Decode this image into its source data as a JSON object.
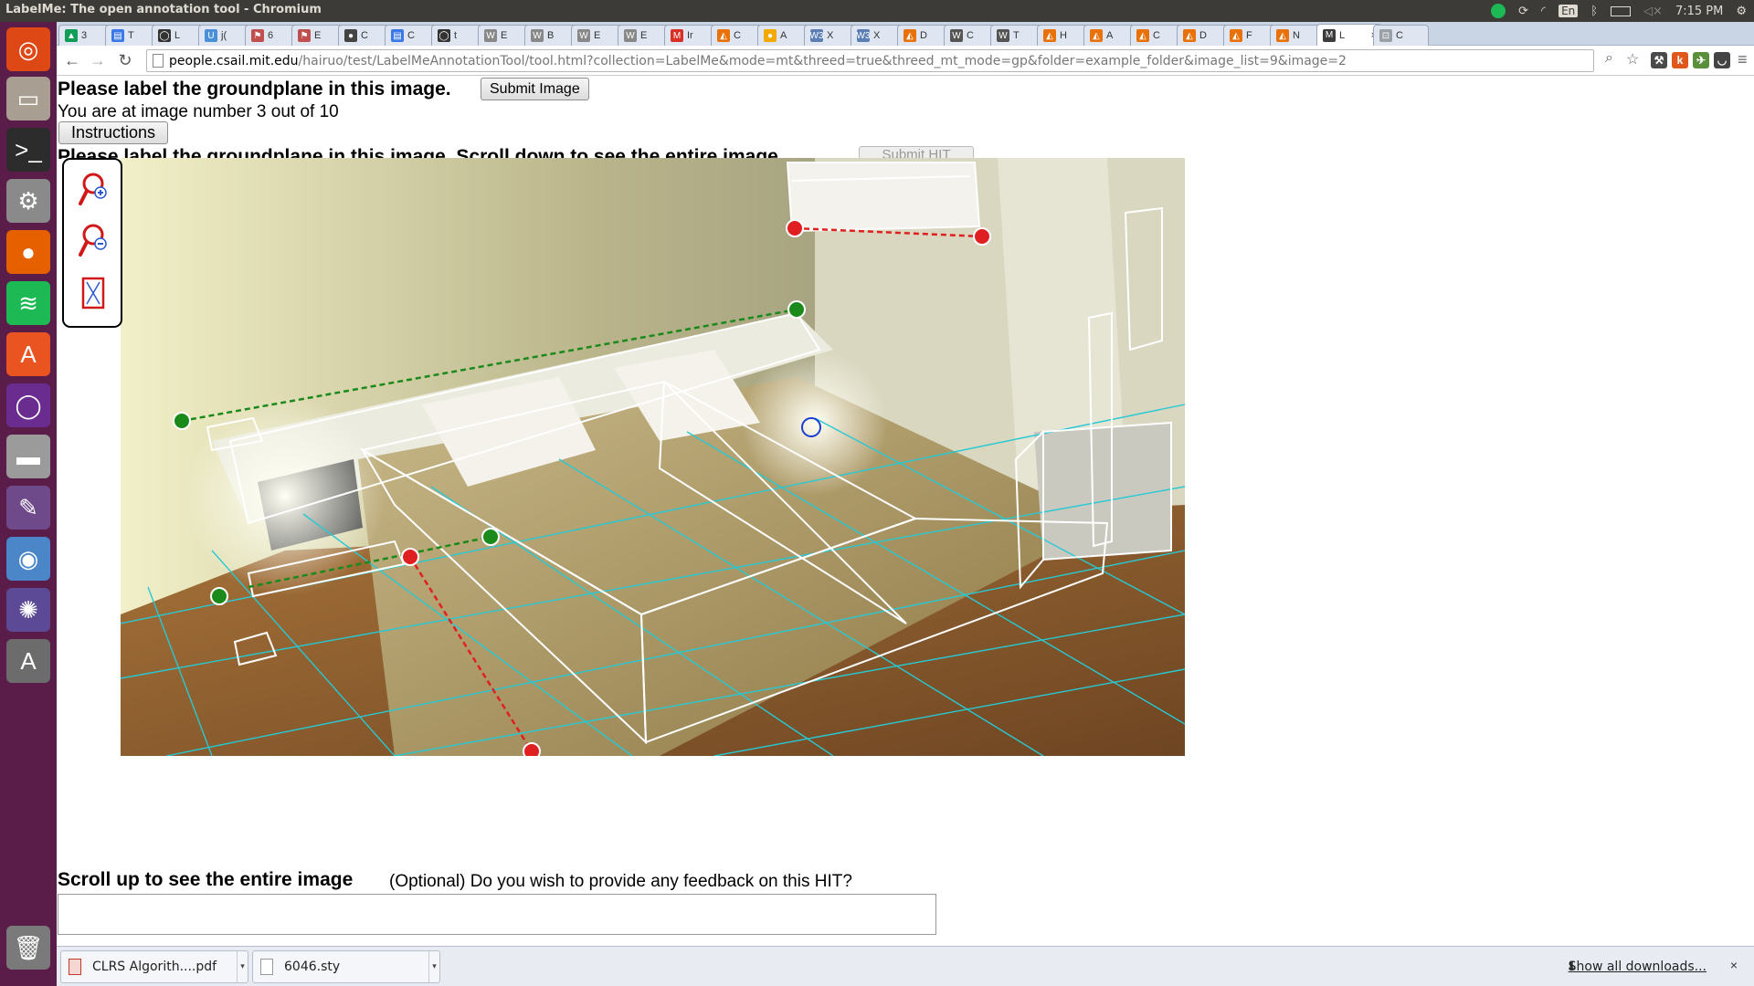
{
  "window": {
    "title": "LabelMe: The open annotation tool - Chromium"
  },
  "top_panel": {
    "keyboard_layout": "En",
    "clock": "7:15 PM",
    "tray_icons": [
      "spotify-icon",
      "sync-icon",
      "wifi-icon",
      "keyboard-icon",
      "bluetooth-icon",
      "battery-icon",
      "volume-icon",
      "settings-gear-icon"
    ]
  },
  "launcher": {
    "items": [
      {
        "name": "ubuntu-dash-icon",
        "color": "#dd4814",
        "glyph": "◎"
      },
      {
        "name": "files-icon",
        "color": "#a89f92",
        "glyph": "▭"
      },
      {
        "name": "terminal-icon",
        "color": "#2c2c2c",
        "glyph": ">_"
      },
      {
        "name": "system-settings-icon",
        "color": "#8a8a8a",
        "glyph": "⚙"
      },
      {
        "name": "firefox-icon",
        "color": "#e66000",
        "glyph": "●"
      },
      {
        "name": "spotify-icon",
        "color": "#1db954",
        "glyph": "≋"
      },
      {
        "name": "software-center-icon",
        "color": "#e95420",
        "glyph": "A"
      },
      {
        "name": "app-circle-icon",
        "color": "#6a2c8f",
        "glyph": "◯"
      },
      {
        "name": "disk-icon",
        "color": "#9b9b9b",
        "glyph": "▬"
      },
      {
        "name": "texmaker-icon",
        "color": "#6f4a8a",
        "glyph": "✎"
      },
      {
        "name": "chromium-icon",
        "color": "#4a86c8",
        "glyph": "◉"
      },
      {
        "name": "shotwell-icon",
        "color": "#5c4a96",
        "glyph": "✺"
      },
      {
        "name": "update-manager-icon",
        "color": "#6c6c6c",
        "glyph": "A"
      },
      {
        "name": "trash-icon",
        "color": "#7a7a7a",
        "glyph": "🗑"
      }
    ]
  },
  "tabs": [
    {
      "label": "3",
      "fav_color": "#0f9d58",
      "fav": "▲"
    },
    {
      "label": "T",
      "fav_color": "#3b78e7",
      "fav": "▤"
    },
    {
      "label": "L",
      "fav_color": "#333333",
      "fav": "◯"
    },
    {
      "label": "j(",
      "fav_color": "#4a90d9",
      "fav": "U"
    },
    {
      "label": "6",
      "fav_color": "#c0504d",
      "fav": "⚑"
    },
    {
      "label": "E",
      "fav_color": "#c0504d",
      "fav": "⚑"
    },
    {
      "label": "C",
      "fav_color": "#444444",
      "fav": "●"
    },
    {
      "label": "C",
      "fav_color": "#3b78e7",
      "fav": "▤"
    },
    {
      "label": "t",
      "fav_color": "#333333",
      "fav": "◯"
    },
    {
      "label": "E",
      "fav_color": "#888888",
      "fav": "W"
    },
    {
      "label": "B",
      "fav_color": "#888888",
      "fav": "W"
    },
    {
      "label": "E",
      "fav_color": "#888888",
      "fav": "W"
    },
    {
      "label": "E",
      "fav_color": "#888888",
      "fav": "W"
    },
    {
      "label": "Ir",
      "fav_color": "#d93025",
      "fav": "M"
    },
    {
      "label": "C",
      "fav_color": "#e8710a",
      "fav": "◭"
    },
    {
      "label": "A",
      "fav_color": "#f2a900",
      "fav": "●"
    },
    {
      "label": "X",
      "fav_color": "#5b7fb5",
      "fav": "W3"
    },
    {
      "label": "X",
      "fav_color": "#5b7fb5",
      "fav": "W3"
    },
    {
      "label": "D",
      "fav_color": "#e8710a",
      "fav": "◭"
    },
    {
      "label": "C",
      "fav_color": "#555555",
      "fav": "W"
    },
    {
      "label": "T",
      "fav_color": "#555555",
      "fav": "W"
    },
    {
      "label": "H",
      "fav_color": "#e8710a",
      "fav": "◭"
    },
    {
      "label": "A",
      "fav_color": "#e8710a",
      "fav": "◭"
    },
    {
      "label": "C",
      "fav_color": "#e8710a",
      "fav": "◭"
    },
    {
      "label": "D",
      "fav_color": "#e8710a",
      "fav": "◭"
    },
    {
      "label": "F",
      "fav_color": "#e8710a",
      "fav": "◭"
    },
    {
      "label": "N",
      "fav_color": "#e8710a",
      "fav": "◭"
    },
    {
      "label": "L",
      "fav_color": "#3b3b3b",
      "fav": "M",
      "active": true,
      "close": "×"
    },
    {
      "label": "C",
      "fav_color": "#9aa0a6",
      "fav": "⊡"
    }
  ],
  "toolbar": {
    "back": "←",
    "forward": "→",
    "reload": "↻",
    "url_host": "people.csail.mit.edu",
    "url_path": "/hairuo/test/LabelMeAnnotationTool/tool.html?collection=LabelMe&mode=mt&threed=true&threed_mt_mode=gp&folder=example_folder&image_list=9&image=2",
    "zoom_icon": "⌕",
    "star_icon": "☆",
    "menu_icon": "≡",
    "extensions": [
      {
        "name": "extension-1-icon",
        "color": "#4a4a4a",
        "glyph": "⚒"
      },
      {
        "name": "extension-k-icon",
        "color": "#e0571b",
        "glyph": "k"
      },
      {
        "name": "extension-2-icon",
        "color": "#5a8f3c",
        "glyph": "✈"
      },
      {
        "name": "pocket-icon",
        "color": "#444444",
        "glyph": "◡"
      }
    ]
  },
  "page": {
    "prompt": "Please label the groundplane in this image.",
    "submit_image": "Submit Image",
    "image_count": "You are at image number 3 out of 10",
    "instructions": "Instructions",
    "prompt_hidden": "Please label the groundplane in this image. Scroll down to see the entire image.",
    "submit_hit": "Submit HIT",
    "scroll_note": "Scroll up to see the entire image",
    "feedback_question": "(Optional) Do you wish to provide any feedback on this HIT?",
    "feedback_value": "",
    "tools": [
      {
        "name": "zoom-in-icon"
      },
      {
        "name": "zoom-out-icon"
      },
      {
        "name": "fit-image-icon"
      }
    ]
  },
  "scene": {
    "colors": {
      "grid": "#27c9d4",
      "box": "#ffffff",
      "red_line": "#e02020",
      "green_line": "#1a8a1a",
      "blue_handle": "#1a3fd0"
    }
  },
  "downloads": {
    "items": [
      {
        "label": "CLRS Algorith....pdf",
        "type": "pdf"
      },
      {
        "label": "6046.sty",
        "type": "file"
      }
    ],
    "show_all": "Show all downloads...",
    "close": "×"
  }
}
